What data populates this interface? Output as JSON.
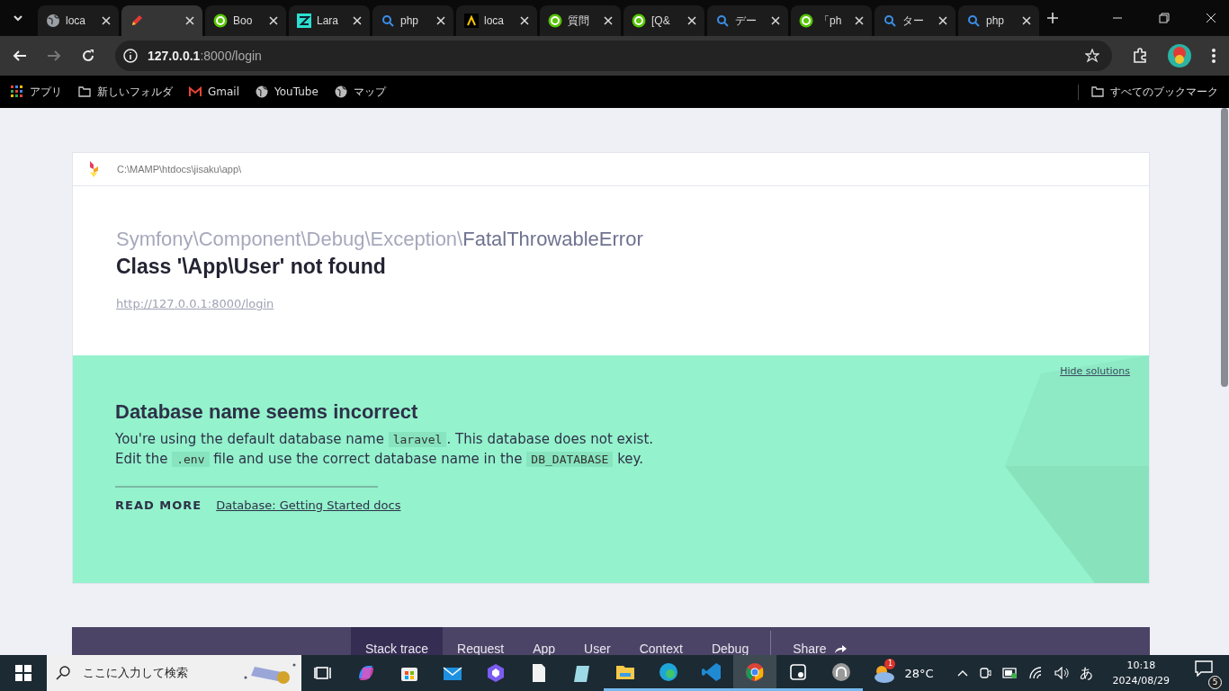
{
  "browser": {
    "tabs": [
      {
        "title": "loca",
        "kind": "globe",
        "selected": false
      },
      {
        "kind": "pencil",
        "selected": true
      },
      {
        "title": "Boo",
        "kind": "qiita",
        "selected": false
      },
      {
        "title": "Lara",
        "kind": "lara",
        "selected": false
      },
      {
        "title": "php",
        "kind": "search",
        "selected": false
      },
      {
        "title": "loca",
        "kind": "caret",
        "selected": false
      },
      {
        "title": "質問",
        "kind": "qiita",
        "selected": false
      },
      {
        "title": "[Q&",
        "kind": "qiita",
        "selected": false
      },
      {
        "title": "デー",
        "kind": "search",
        "selected": false
      },
      {
        "title": "「ph",
        "kind": "qiita",
        "selected": false
      },
      {
        "title": "ター",
        "kind": "search",
        "selected": false
      },
      {
        "title": "php",
        "kind": "search",
        "selected": false
      }
    ],
    "address": {
      "host": "127.0.0.1",
      "path": ":8000/login"
    },
    "bookmarks": [
      {
        "label": "アプリ",
        "kind": "apps"
      },
      {
        "label": "新しいフォルダ",
        "kind": "folder"
      },
      {
        "label": "Gmail",
        "kind": "gmail"
      },
      {
        "label": "YouTube",
        "kind": "globe"
      },
      {
        "label": "マップ",
        "kind": "globe"
      }
    ],
    "all_bookmarks": "すべてのブックマーク"
  },
  "error": {
    "path": "C:\\MAMP\\htdocs\\jisaku\\app\\",
    "exception_namespace": "Symfony\\Component\\Debug\\Exception\\",
    "exception_class": "FatalThrowableError",
    "message": "Class '\\App\\User' not found",
    "url": "http://127.0.0.1:8000/login"
  },
  "solution": {
    "hide_link": "Hide solutions",
    "title": "Database name seems incorrect",
    "lines": [
      [
        "You're using the default database name ",
        {
          "code": "laravel"
        },
        ". This database does not exist."
      ],
      [
        "Edit the ",
        {
          "code": ".env"
        },
        " file and use the correct database name in the ",
        {
          "code": "DB_DATABASE"
        },
        " key."
      ]
    ],
    "read_more": "READ MORE",
    "doc_link": "Database: Getting Started docs"
  },
  "nav": {
    "tabs": [
      {
        "label": "Stack trace",
        "selected": true
      },
      {
        "label": "Request",
        "selected": false
      },
      {
        "label": "App",
        "selected": false
      },
      {
        "label": "User",
        "selected": false
      },
      {
        "label": "Context",
        "selected": false
      },
      {
        "label": "Debug",
        "selected": false
      }
    ],
    "share": "Share"
  },
  "taskbar": {
    "search_placeholder": "ここに入力して検索",
    "apps": [
      {
        "kind": "taskview",
        "running": false,
        "selected": false
      },
      {
        "kind": "copilot",
        "running": false,
        "selected": false
      },
      {
        "kind": "store",
        "running": false,
        "selected": false
      },
      {
        "kind": "mail",
        "running": false,
        "selected": false
      },
      {
        "kind": "copilot2",
        "running": false,
        "selected": false
      },
      {
        "kind": "file",
        "running": false,
        "selected": false
      },
      {
        "kind": "notepad",
        "running": false,
        "selected": false
      },
      {
        "kind": "explorer",
        "running": true,
        "selected": false
      },
      {
        "kind": "edge",
        "running": true,
        "selected": false
      },
      {
        "kind": "vscode",
        "running": true,
        "selected": false
      },
      {
        "kind": "chrome",
        "running": true,
        "selected": true
      },
      {
        "kind": "snip",
        "running": true,
        "selected": false
      },
      {
        "kind": "mamp",
        "running": true,
        "selected": false
      }
    ],
    "weather_badge": "1",
    "temperature": "28°C",
    "ime": "あ",
    "time": "10:18",
    "date": "2024/08/29",
    "notifications": "5"
  }
}
